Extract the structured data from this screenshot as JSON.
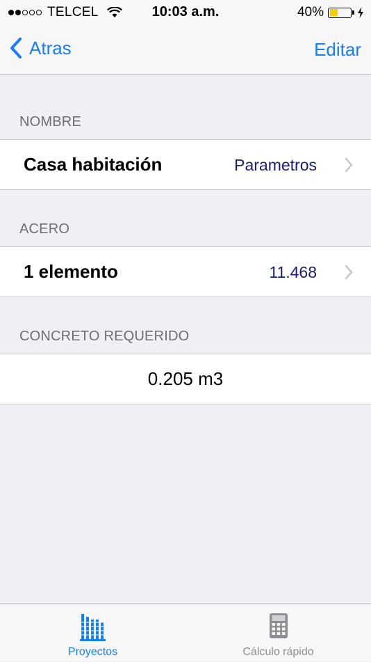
{
  "status_bar": {
    "carrier": "TELCEL",
    "time": "10:03 a.m.",
    "battery_percent": "40%",
    "battery_level": 0.4,
    "signal_bars": 2,
    "signal_total": 5
  },
  "nav": {
    "back_label": "Atras",
    "edit_label": "Editar"
  },
  "sections": {
    "nombre": {
      "header": "NOMBRE",
      "title": "Casa habitación",
      "detail": "Parametros"
    },
    "acero": {
      "header": "ACERO",
      "title": "1 elemento",
      "detail": "11.468"
    },
    "concreto": {
      "header": "CONCRETO REQUERIDO",
      "value": "0.205 m3"
    }
  },
  "tabs": [
    {
      "label": "Proyectos",
      "icon": "building-icon",
      "selected": true
    },
    {
      "label": "Cálculo rápido",
      "icon": "calculator-icon",
      "selected": false
    }
  ],
  "colors": {
    "tint": "#157efb",
    "detail_text": "#1c1c7a",
    "inactive_tab": "#8e8e93",
    "battery_fill": "#ffcc00",
    "background": "#efeff4"
  }
}
